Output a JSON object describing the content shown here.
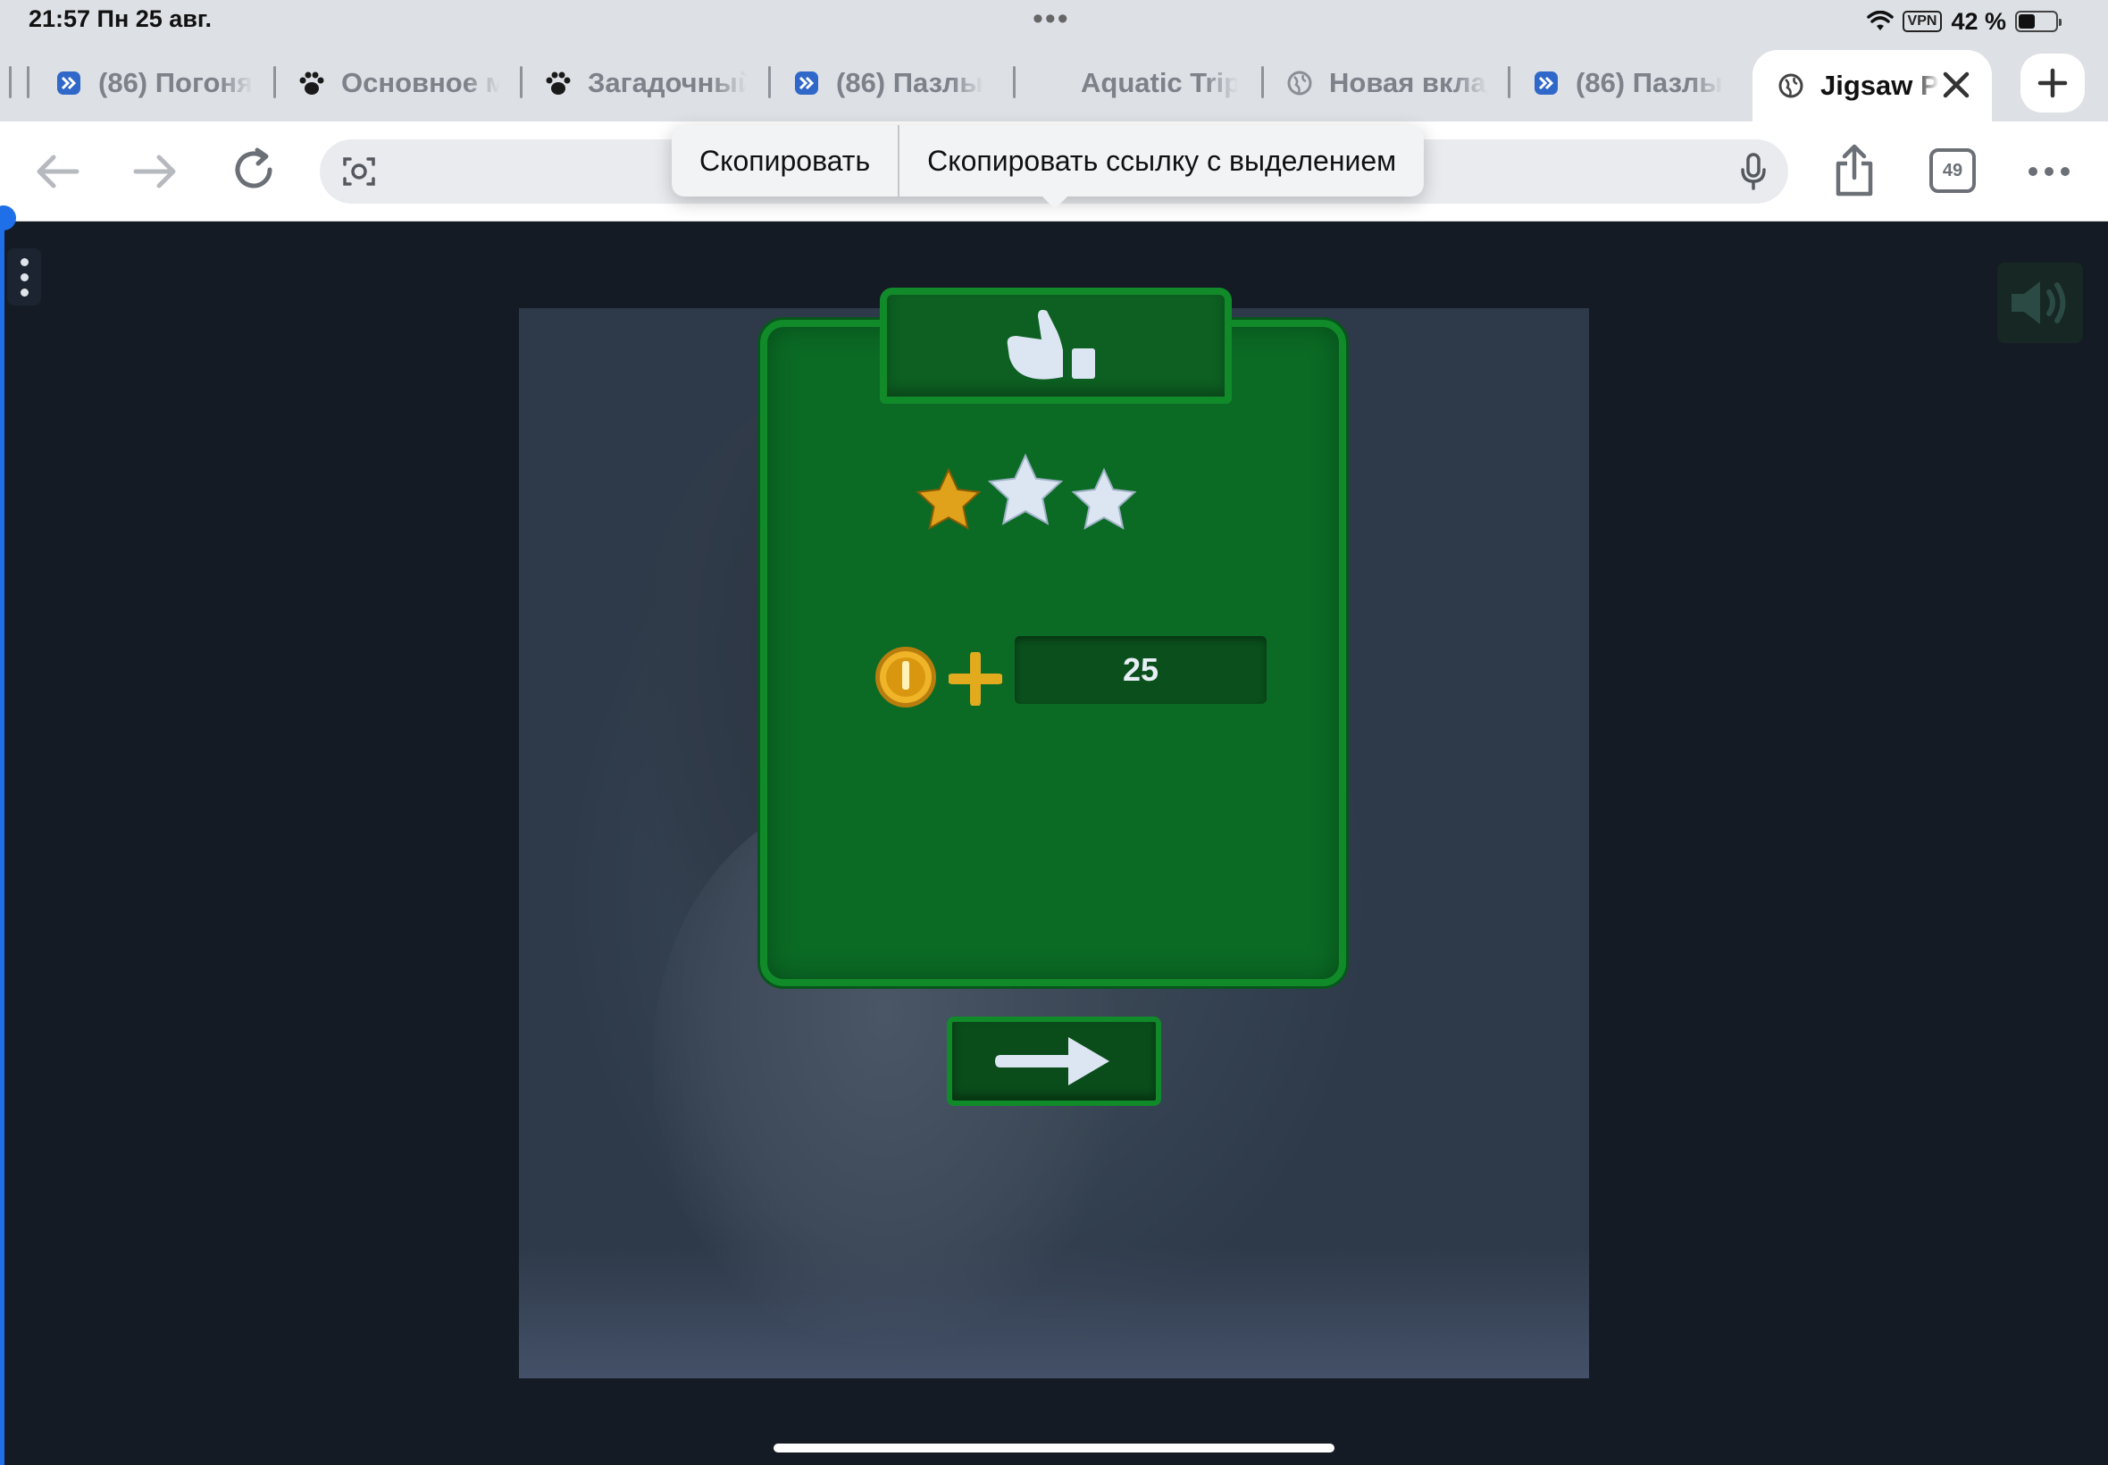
{
  "status_bar": {
    "time_date": "21:57   Пн 25 авг.",
    "vpn": "VPN",
    "battery_percent": "42 %"
  },
  "tabs": [
    {
      "label": "(86) Погоня",
      "icon": "pinwheel-icon"
    },
    {
      "label": "Основное м",
      "icon": "paw-icon"
    },
    {
      "label": "Загадочный",
      "icon": "paw-icon"
    },
    {
      "label": "(86) Пазлы",
      "icon": "pinwheel-icon"
    },
    {
      "label": "Aquatic Trip",
      "icon": ""
    },
    {
      "label": "Новая вкладка",
      "icon": "globe-icon"
    },
    {
      "label": "(86) Пазлы",
      "icon": "pinwheel-icon"
    },
    {
      "label": "Jigsaw P",
      "icon": "globe-icon",
      "active": true
    }
  ],
  "toolbar": {
    "url_value": "",
    "tab_count": "49"
  },
  "context_menu": {
    "copy": "Скопировать",
    "copy_link": "Скопировать ссылку с выделением"
  },
  "game": {
    "stars_earned": 1,
    "stars_total": 3,
    "reward_amount": "25",
    "colors": {
      "panel": "#0b6b25",
      "panel_border": "#118a2a",
      "star_gold": "#e1a21b",
      "star_empty": "#dbe6f2"
    }
  }
}
